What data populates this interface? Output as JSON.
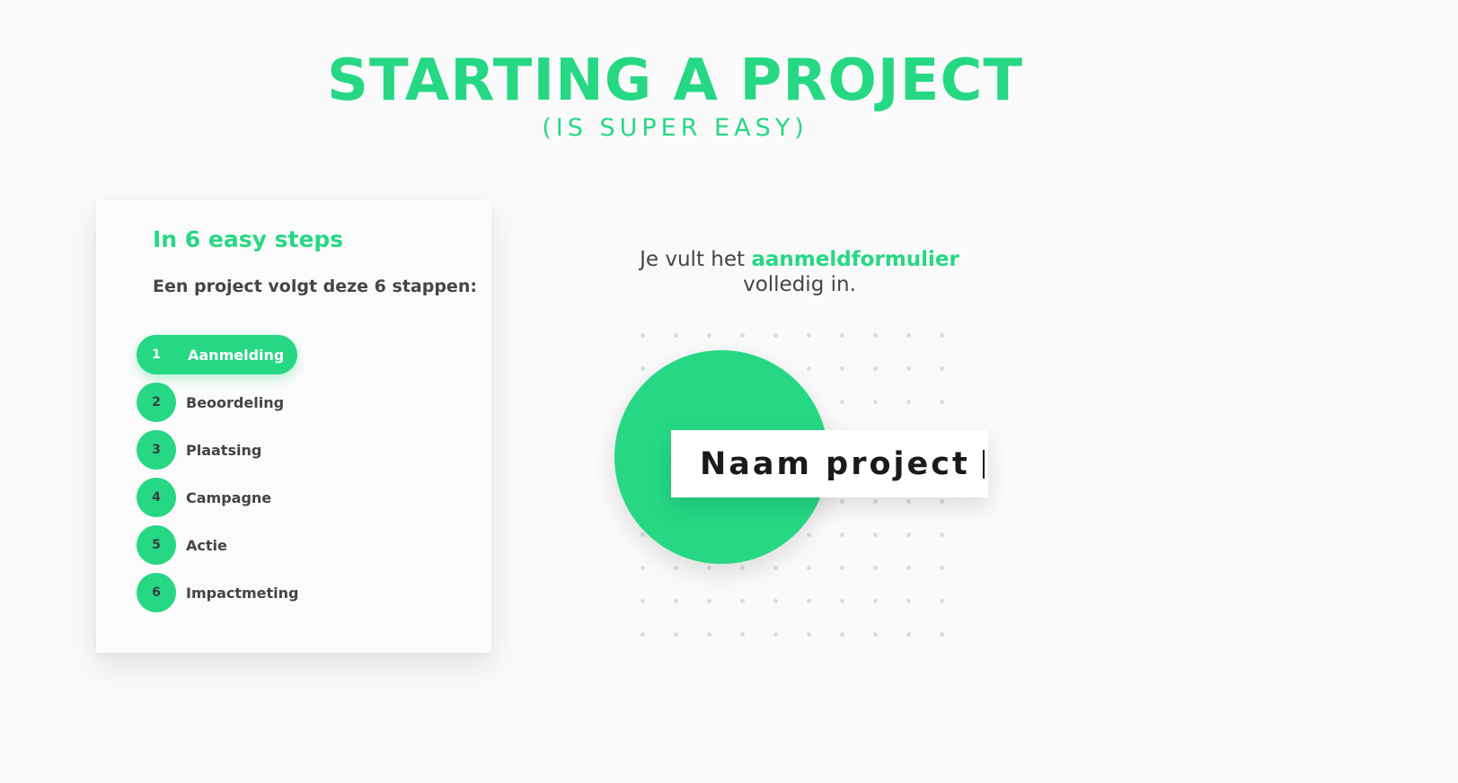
{
  "hero": {
    "title": "STARTING A PROJECT",
    "subtitle": "(IS SUPER EASY)"
  },
  "steps_card": {
    "heading": "In 6 easy steps",
    "intro": "Een project volgt deze 6 stappen:",
    "steps": [
      {
        "number": "1",
        "label": "Aanmelding",
        "active": true
      },
      {
        "number": "2",
        "label": "Beoordeling",
        "active": false
      },
      {
        "number": "3",
        "label": "Plaatsing",
        "active": false
      },
      {
        "number": "4",
        "label": "Campagne",
        "active": false
      },
      {
        "number": "5",
        "label": "Actie",
        "active": false
      },
      {
        "number": "6",
        "label": "Impactmeting",
        "active": false
      }
    ]
  },
  "illustration": {
    "caption_before": "Je vult het ",
    "caption_accent": "aanmeldformulier",
    "caption_after": "volledig in.",
    "field_text": "Naam project"
  },
  "colors": {
    "accent": "#26d884",
    "text": "#444444",
    "background": "#fafafa"
  }
}
